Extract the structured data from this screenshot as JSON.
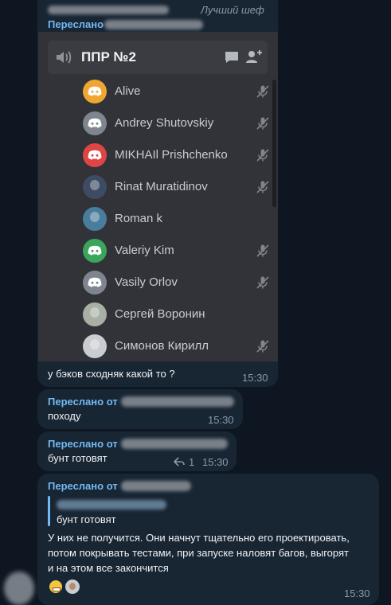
{
  "colors": {
    "bg": "#0e1621",
    "bubble": "#182533",
    "accent": "#71baf2"
  },
  "msg1": {
    "author_tag": "Лучший шеф",
    "forward_label": "Переслано",
    "discord": {
      "channel": "ППР №2",
      "icons": [
        "speaker-icon",
        "chat-icon",
        "add-member-icon"
      ],
      "users": [
        {
          "name": "Alive",
          "avatar_color": "#f0a732",
          "icon": "discord-logo",
          "muted": true
        },
        {
          "name": "Andrey Shutovskiy",
          "avatar_color": "#7e858f",
          "icon": "discord-logo",
          "muted": true
        },
        {
          "name": "MIKHAIl Prishchenko",
          "avatar_color": "#e04545",
          "icon": "discord-logo",
          "muted": true
        },
        {
          "name": "Rinat Muratidinov",
          "avatar_color": "#3d4b63",
          "icon": "photo",
          "muted": true
        },
        {
          "name": "Roman k",
          "avatar_color": "#4a7d9c",
          "icon": "photo",
          "muted": false
        },
        {
          "name": "Valeriy Kim",
          "avatar_color": "#3ba55c",
          "icon": "discord-logo",
          "muted": true
        },
        {
          "name": "Vasily Orlov",
          "avatar_color": "#7e858f",
          "icon": "discord-logo",
          "muted": true
        },
        {
          "name": "Сергей Воронин",
          "avatar_color": "#a8b0a6",
          "icon": "photo",
          "muted": false
        },
        {
          "name": "Симонов Кирилл",
          "avatar_color": "#c9cdd1",
          "icon": "photo",
          "muted": true
        }
      ]
    },
    "text": "у бэков сходняк какой то ?",
    "time": "15:30"
  },
  "msg2": {
    "forward_label": "Переслано от",
    "text": "походу",
    "time": "15:30"
  },
  "msg3": {
    "forward_label": "Переслано от",
    "text": "бунт готовят",
    "reply_count": "1",
    "time": "15:30"
  },
  "msg4": {
    "forward_label": "Переслано от",
    "quote_text": "бунт готовят",
    "text_lines": [
      "У них не получится. Они начнут тщательно его проектировать,",
      "потом покрывать тестами, при запуске наловят багов, выгорят",
      "и на этом все закончится"
    ],
    "reactions": [
      "grinning-face-reaction",
      "user-avatar-reaction"
    ],
    "time": "15:30"
  }
}
